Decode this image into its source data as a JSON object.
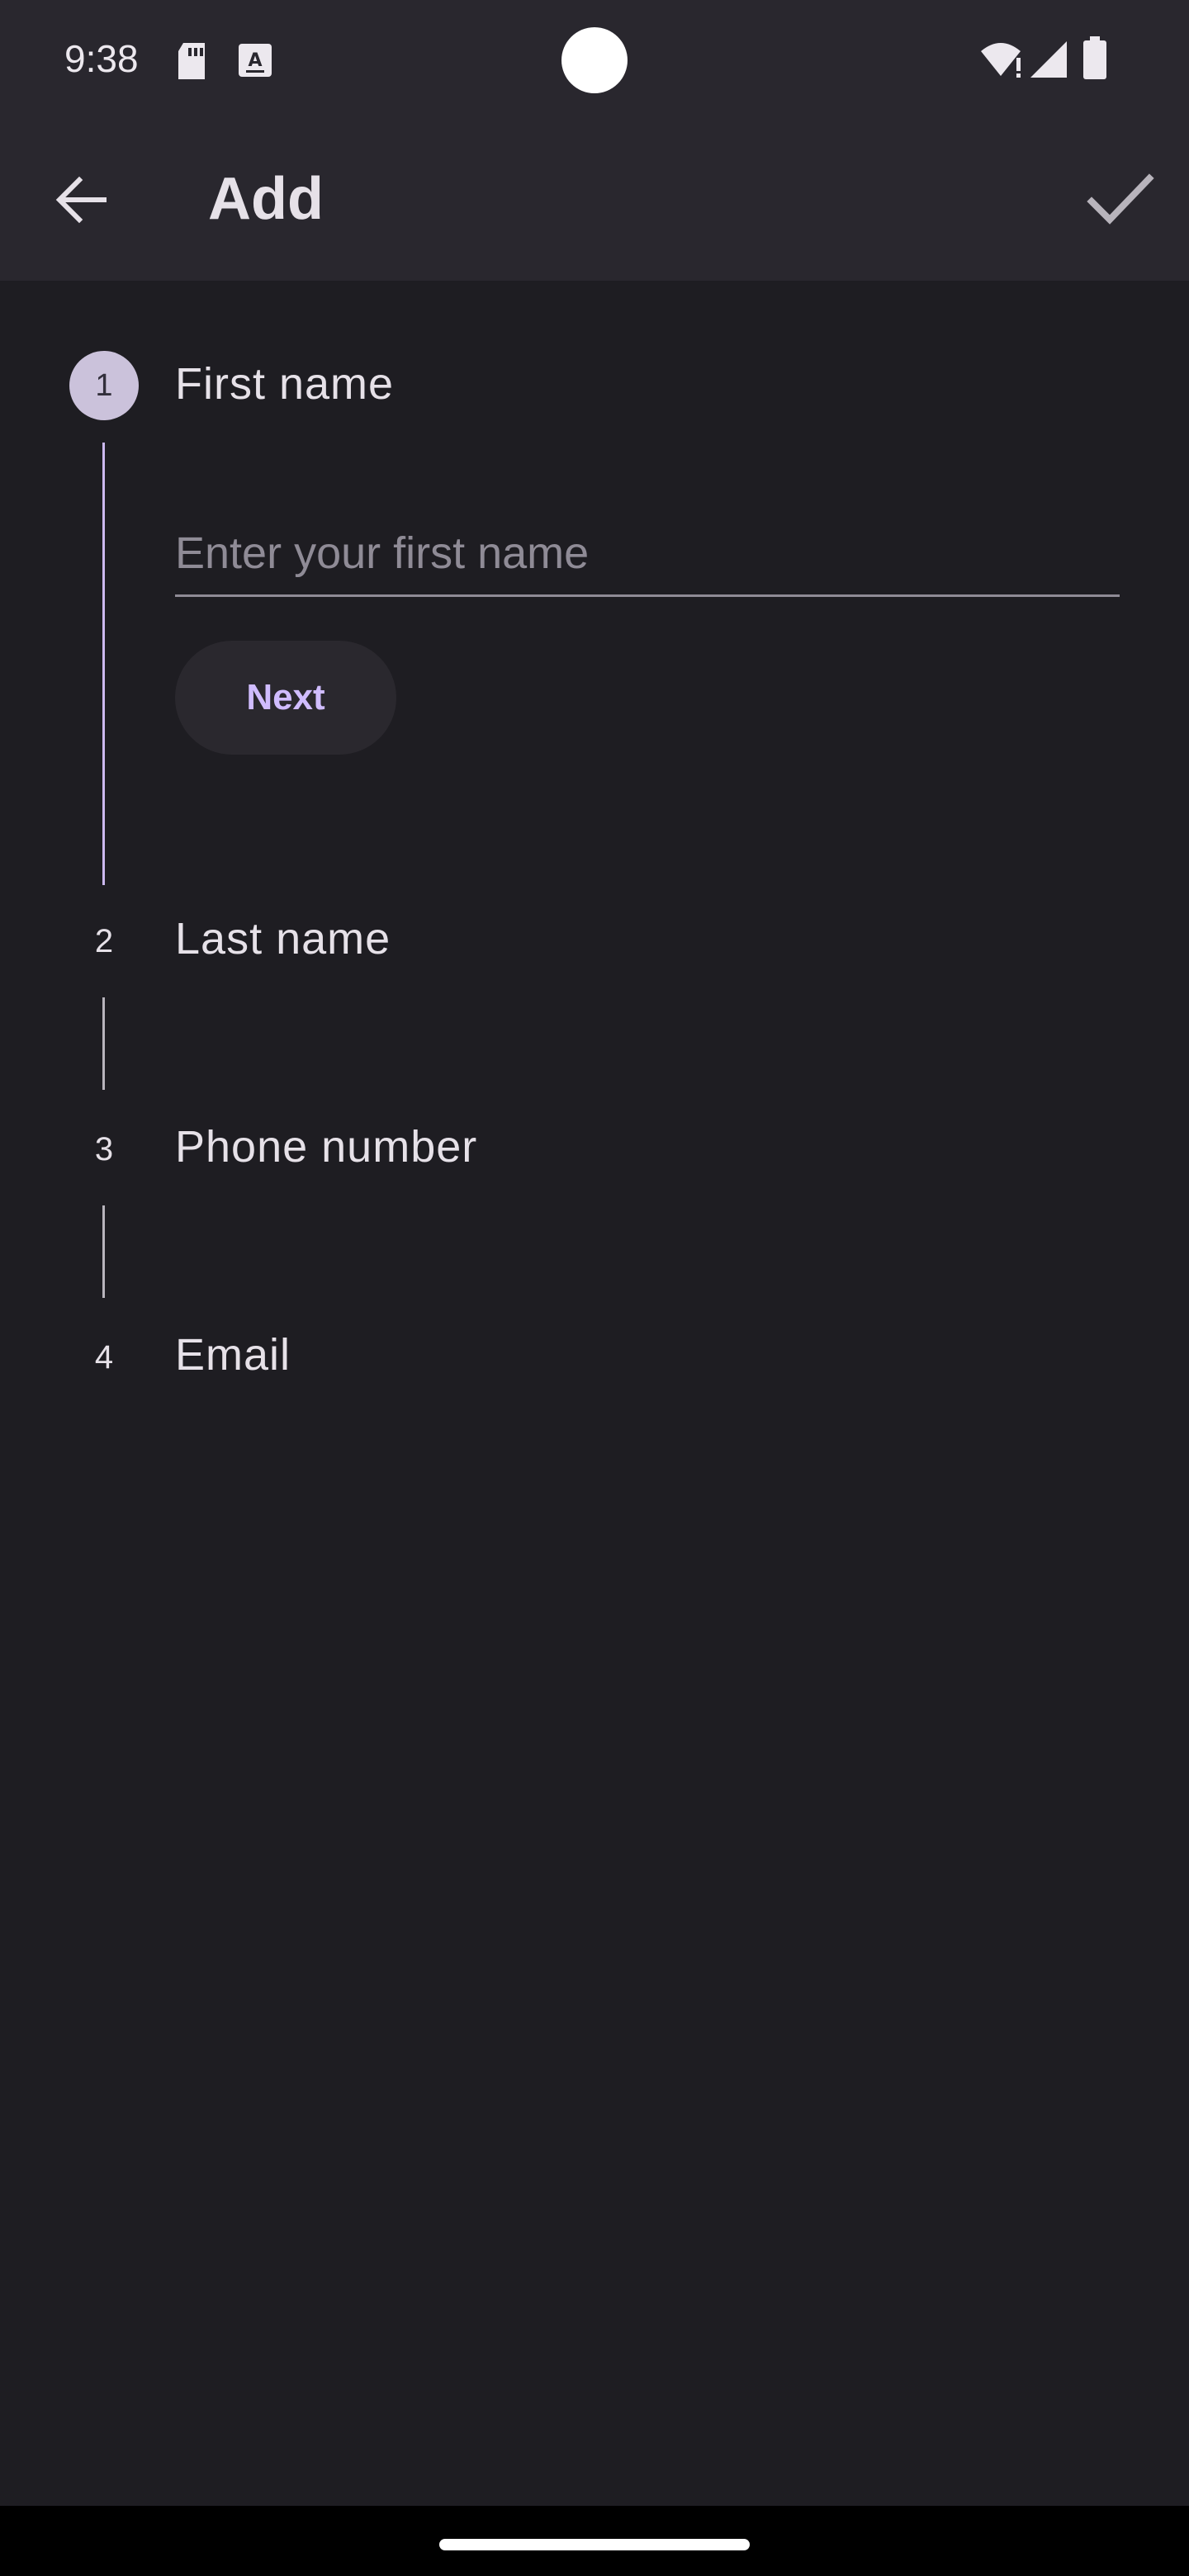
{
  "status_bar": {
    "time": "9:38",
    "icons": [
      "sd-card-icon",
      "a-box-icon",
      "wifi-alert-icon",
      "signal-icon",
      "battery-icon"
    ]
  },
  "app_bar": {
    "title": "Add",
    "back_icon": "arrow-left-icon",
    "confirm_icon": "check-icon"
  },
  "stepper": {
    "steps": [
      {
        "number": "1",
        "title": "First name",
        "active": true
      },
      {
        "number": "2",
        "title": "Last name",
        "active": false
      },
      {
        "number": "3",
        "title": "Phone number",
        "active": false
      },
      {
        "number": "4",
        "title": "Email",
        "active": false
      }
    ],
    "input": {
      "value": "",
      "placeholder": "Enter your first name"
    },
    "next_label": "Next"
  },
  "colors": {
    "background": "#1e1d22",
    "bar_background": "#29272e",
    "accent": "#d0bcff",
    "active_step": "#cbc2db",
    "text": "#e6e1e8"
  }
}
